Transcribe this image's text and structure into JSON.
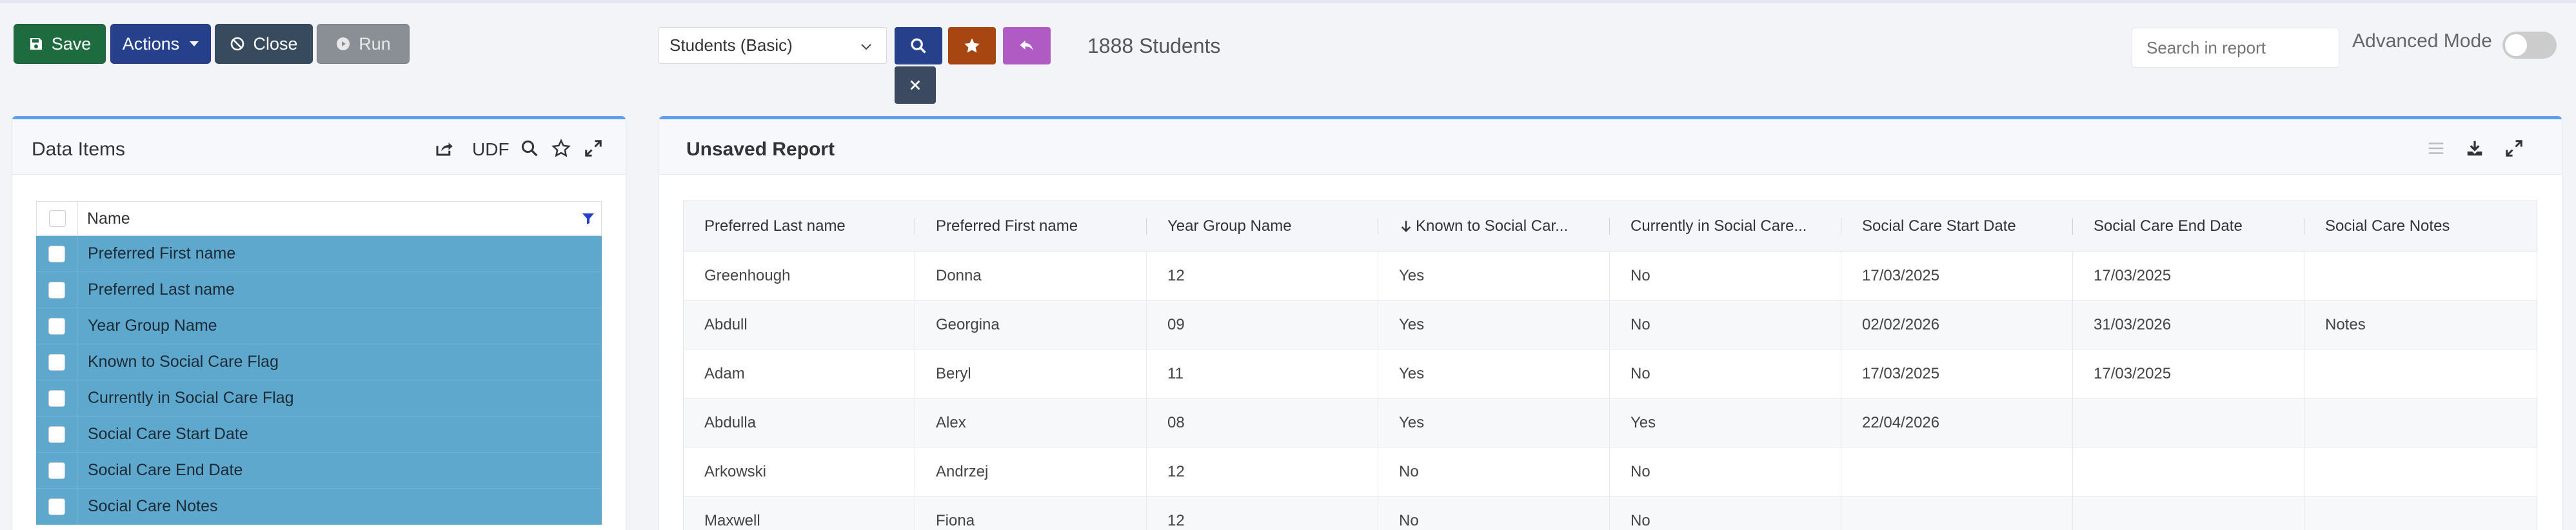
{
  "toolbar": {
    "save_label": "Save",
    "actions_label": "Actions",
    "close_label": "Close",
    "run_label": "Run"
  },
  "report_select": {
    "value": "Students (Basic)"
  },
  "student_count": "1888 Students",
  "search": {
    "placeholder": "Search in report"
  },
  "advanced_mode": {
    "label": "Advanced Mode",
    "enabled": false
  },
  "data_items": {
    "title": "Data Items",
    "udf_label": "UDF",
    "column_header": "Name",
    "items": [
      "Preferred First name",
      "Preferred Last name",
      "Year Group Name",
      "Known to Social Care Flag",
      "Currently in Social Care Flag",
      "Social Care Start Date",
      "Social Care End Date",
      "Social Care Notes"
    ]
  },
  "report": {
    "title": "Unsaved Report",
    "columns": [
      "Preferred Last name",
      "Preferred First name",
      "Year Group Name",
      "Known to Social Car...",
      "Currently in Social Care...",
      "Social Care Start Date",
      "Social Care End Date",
      "Social Care Notes"
    ],
    "rows": [
      [
        "Greenhough",
        "Donna",
        "12",
        "Yes",
        "No",
        "17/03/2025",
        "17/03/2025",
        ""
      ],
      [
        "Abdull",
        "Georgina",
        "09",
        "Yes",
        "No",
        "02/02/2026",
        "31/03/2026",
        "Notes"
      ],
      [
        "Adam",
        "Beryl",
        "11",
        "Yes",
        "No",
        "17/03/2025",
        "17/03/2025",
        ""
      ],
      [
        "Abdulla",
        "Alex",
        "08",
        "Yes",
        "Yes",
        "22/04/2026",
        "",
        ""
      ],
      [
        "Arkowski",
        "Andrzej",
        "12",
        "No",
        "No",
        "",
        "",
        ""
      ],
      [
        "Maxwell",
        "Fiona",
        "12",
        "No",
        "No",
        "",
        "",
        ""
      ]
    ]
  },
  "colors": {
    "save": "#1e6b40",
    "actions": "#27408b",
    "close": "#384a5e",
    "star": "#a84612",
    "back": "#b05bc4",
    "panel_accent": "#5f9ef0",
    "selected_row": "#5ea8cd"
  }
}
